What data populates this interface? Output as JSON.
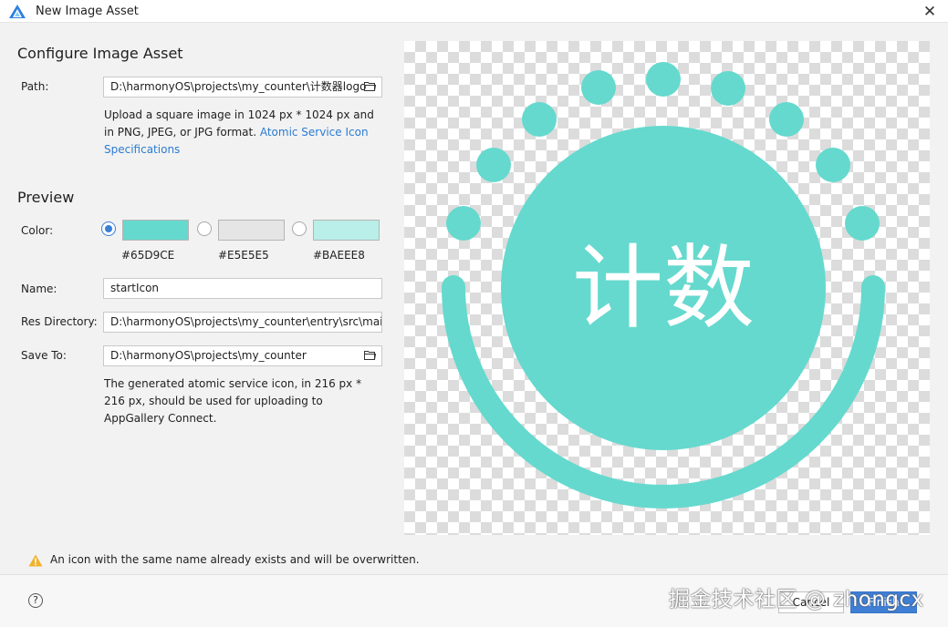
{
  "window": {
    "title": "New Image Asset",
    "close_icon": "close-icon"
  },
  "configure": {
    "title": "Configure Image Asset",
    "path_label": "Path:",
    "path_value": "D:\\harmonyOS\\projects\\my_counter\\计数器logo",
    "help_text": "Upload a square image in 1024 px * 1024 px and in PNG, JPEG, or JPG format. ",
    "help_link": "Atomic Service Icon Specifications"
  },
  "preview": {
    "title": "Preview",
    "color_label": "Color:",
    "colors": [
      {
        "hex": "#65D9CE",
        "label": "#65D9CE",
        "selected": true
      },
      {
        "hex": "#E5E5E5",
        "label": "#E5E5E5",
        "selected": false
      },
      {
        "hex": "#BAEEE8",
        "label": "#BAEEE8",
        "selected": false
      }
    ],
    "icon_text": "计数",
    "icon_color": "#65D9CE"
  },
  "form": {
    "name_label": "Name:",
    "name_value": "startIcon",
    "res_dir_label": "Res Directory:",
    "res_dir_value": "D:\\harmonyOS\\projects\\my_counter\\entry\\src\\main",
    "save_to_label": "Save To:",
    "save_to_value": "D:\\harmonyOS\\projects\\my_counter",
    "save_note": "The generated atomic service icon, in 216 px * 216 px, should be used for uploading to AppGallery Connect."
  },
  "warning": {
    "text": "An icon with the same name already exists and will be overwritten."
  },
  "footer": {
    "help": "?",
    "cancel": "Cancel",
    "finish": "Finish"
  },
  "watermark": "掘金技术社区 @ zhongcx"
}
